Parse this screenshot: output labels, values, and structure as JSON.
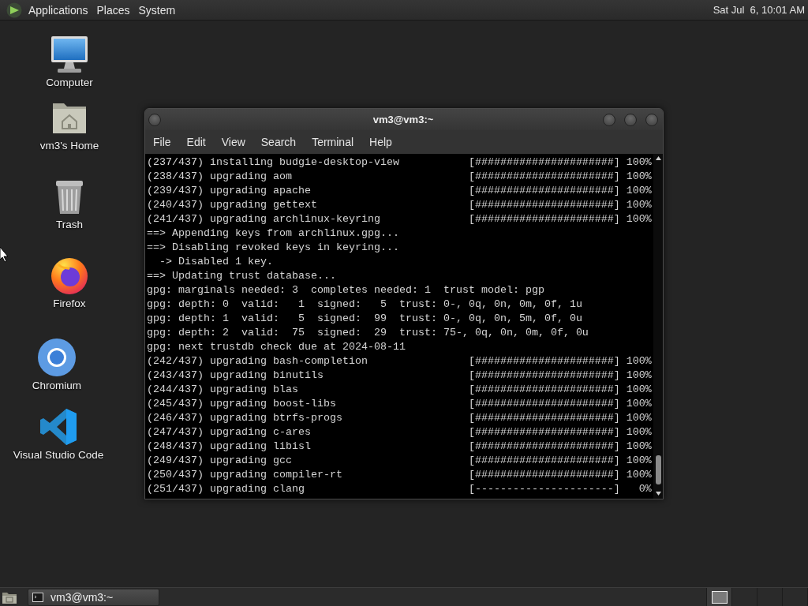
{
  "top_panel": {
    "menus": [
      "Applications",
      "Places",
      "System"
    ],
    "clock": "Sat Jul  6, 10:01 AM"
  },
  "desktop_icons": [
    {
      "kind": "computer",
      "label": "Computer"
    },
    {
      "kind": "home",
      "label": "vm3's Home"
    },
    {
      "kind": "trash",
      "label": "Trash"
    },
    {
      "kind": "firefox",
      "label": "Firefox"
    },
    {
      "kind": "chromium",
      "label": "Chromium"
    },
    {
      "kind": "vscode",
      "label": "Visual Studio Code"
    }
  ],
  "terminal_window": {
    "title": "vm3@vm3:~",
    "menus": [
      "File",
      "Edit",
      "View",
      "Search",
      "Terminal",
      "Help"
    ],
    "lines": [
      {
        "kind": "progress",
        "label": "(237/437) installing budgie-desktop-view",
        "bar": "[######################]",
        "percent": "100%"
      },
      {
        "kind": "progress",
        "label": "(238/437) upgrading aom",
        "bar": "[######################]",
        "percent": "100%"
      },
      {
        "kind": "progress",
        "label": "(239/437) upgrading apache",
        "bar": "[######################]",
        "percent": "100%"
      },
      {
        "kind": "progress",
        "label": "(240/437) upgrading gettext",
        "bar": "[######################]",
        "percent": "100%"
      },
      {
        "kind": "progress",
        "label": "(241/437) upgrading archlinux-keyring",
        "bar": "[######################]",
        "percent": "100%"
      },
      {
        "kind": "text",
        "text": "==> Appending keys from archlinux.gpg..."
      },
      {
        "kind": "text",
        "text": "==> Disabling revoked keys in keyring..."
      },
      {
        "kind": "text",
        "text": "  -> Disabled 1 key."
      },
      {
        "kind": "text",
        "text": "==> Updating trust database..."
      },
      {
        "kind": "text",
        "text": "gpg: marginals needed: 3  completes needed: 1  trust model: pgp"
      },
      {
        "kind": "text",
        "text": "gpg: depth: 0  valid:   1  signed:   5  trust: 0-, 0q, 0n, 0m, 0f, 1u"
      },
      {
        "kind": "text",
        "text": "gpg: depth: 1  valid:   5  signed:  99  trust: 0-, 0q, 0n, 5m, 0f, 0u"
      },
      {
        "kind": "text",
        "text": "gpg: depth: 2  valid:  75  signed:  29  trust: 75-, 0q, 0n, 0m, 0f, 0u"
      },
      {
        "kind": "text",
        "text": "gpg: next trustdb check due at 2024-08-11"
      },
      {
        "kind": "progress",
        "label": "(242/437) upgrading bash-completion",
        "bar": "[######################]",
        "percent": "100%"
      },
      {
        "kind": "progress",
        "label": "(243/437) upgrading binutils",
        "bar": "[######################]",
        "percent": "100%"
      },
      {
        "kind": "progress",
        "label": "(244/437) upgrading blas",
        "bar": "[######################]",
        "percent": "100%"
      },
      {
        "kind": "progress",
        "label": "(245/437) upgrading boost-libs",
        "bar": "[######################]",
        "percent": "100%"
      },
      {
        "kind": "progress",
        "label": "(246/437) upgrading btrfs-progs",
        "bar": "[######################]",
        "percent": "100%"
      },
      {
        "kind": "progress",
        "label": "(247/437) upgrading c-ares",
        "bar": "[######################]",
        "percent": "100%"
      },
      {
        "kind": "progress",
        "label": "(248/437) upgrading libisl",
        "bar": "[######################]",
        "percent": "100%"
      },
      {
        "kind": "progress",
        "label": "(249/437) upgrading gcc",
        "bar": "[######################]",
        "percent": "100%"
      },
      {
        "kind": "progress",
        "label": "(250/437) upgrading compiler-rt",
        "bar": "[######################]",
        "percent": "100%"
      },
      {
        "kind": "progress",
        "label": "(251/437) upgrading clang",
        "bar": "[----------------------]",
        "percent": "0%"
      }
    ]
  },
  "bottom_panel": {
    "tasks": [
      {
        "label": "vm3@vm3:~",
        "selected": true
      }
    ],
    "workspaces": [
      {
        "selected": true,
        "has_window": true
      },
      {
        "selected": false,
        "has_window": false
      },
      {
        "selected": false,
        "has_window": false
      },
      {
        "selected": false,
        "has_window": false
      }
    ]
  }
}
